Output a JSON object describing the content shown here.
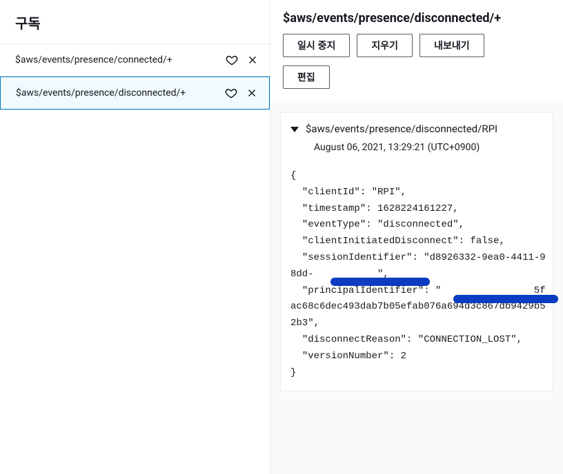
{
  "left": {
    "title": "구독",
    "subscriptions": [
      {
        "topic": "$aws/events/presence/connected/+",
        "selected": false
      },
      {
        "topic": "$aws/events/presence/disconnected/+",
        "selected": true
      }
    ]
  },
  "right": {
    "topic_title": "$aws/events/presence/disconnected/+",
    "buttons": {
      "pause": "일시 중지",
      "clear": "지우기",
      "export": "내보내기",
      "edit": "편집"
    },
    "message": {
      "topic": "$aws/events/presence/disconnected/RPI",
      "timestamp": "August 06, 2021, 13:29:21 (UTC+0900)",
      "payload": {
        "clientId": "RPI",
        "timestamp": 1628224161227,
        "eventType": "disconnected",
        "clientInitiatedDisconnect": false,
        "sessionIdentifier": "d8926332-9ea0-4411-98dd-████████████",
        "principalIdentifier": "████████████5fac68c6dec493dab7b05efab076a694d3c867db9429b52b3",
        "disconnectReason": "CONNECTION_LOST",
        "versionNumber": 2
      },
      "payload_display": "{\n  \"clientId\": \"RPI\",\n  \"timestamp\": 1628224161227,\n  \"eventType\": \"disconnected\",\n  \"clientInitiatedDisconnect\": false,\n  \"sessionIdentifier\": \"d8926332-9ea0-4411-98dd-           \",\n  \"principalIdentifier\": \"                5fac68c6dec493dab7b05efab076a694d3c867db9429b52b3\",\n  \"disconnectReason\": \"CONNECTION_LOST\",\n  \"versionNumber\": 2\n}"
    }
  }
}
